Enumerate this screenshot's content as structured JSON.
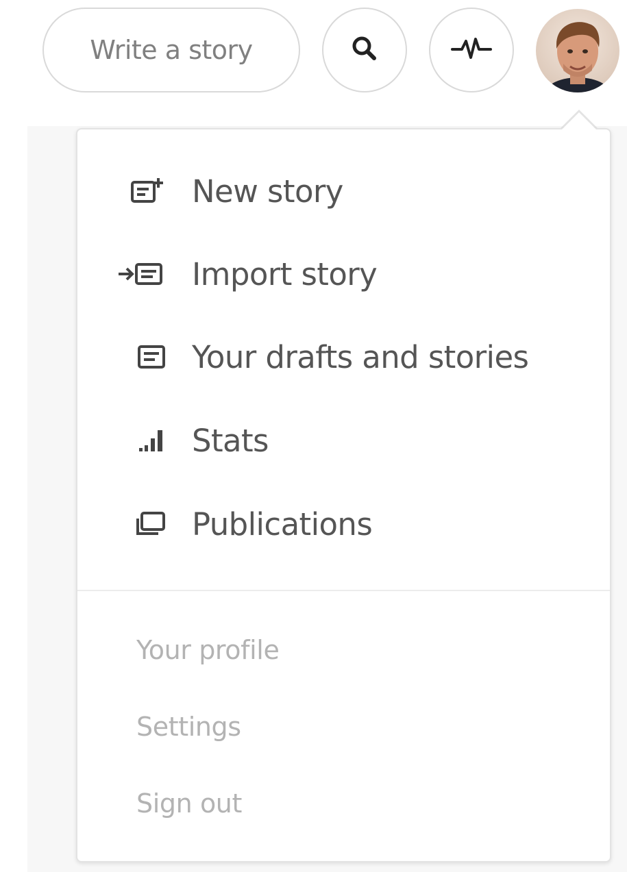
{
  "header": {
    "write_button_label": "Write a story",
    "search_icon": "search-icon",
    "activity_icon": "activity-pulse-icon",
    "avatar": "user-avatar"
  },
  "menu": {
    "primary_items": [
      {
        "label": "New story",
        "icon": "new-story-icon"
      },
      {
        "label": "Import story",
        "icon": "import-story-icon"
      },
      {
        "label": "Your drafts and stories",
        "icon": "drafts-icon"
      },
      {
        "label": "Stats",
        "icon": "stats-icon"
      },
      {
        "label": "Publications",
        "icon": "publications-icon"
      }
    ],
    "secondary_items": [
      {
        "label": "Your profile"
      },
      {
        "label": "Settings"
      },
      {
        "label": "Sign out"
      }
    ]
  },
  "colors": {
    "border": "#d9d9d9",
    "primary_text": "#555555",
    "secondary_text": "#b3b3b3",
    "button_text": "#808080",
    "backdrop": "#f7f7f7"
  }
}
